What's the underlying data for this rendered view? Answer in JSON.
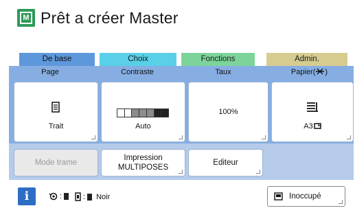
{
  "header": {
    "title": "Prêt a créer Master",
    "icon": "master-icon"
  },
  "tabs": [
    {
      "label": "De base",
      "color": "#5e98dc",
      "active": true
    },
    {
      "label": "Choix",
      "color": "#59d0e8"
    },
    {
      "label": "Fonctions",
      "color": "#7dd49a"
    },
    {
      "label": "Admin.",
      "color": "#d7cc90"
    }
  ],
  "columns": [
    {
      "label": "Page",
      "value": "Trait",
      "icon": "document-icon"
    },
    {
      "label": "Contraste",
      "value": "Auto",
      "icon": "contrast-scale-icon"
    },
    {
      "label": "Taux",
      "value": "100%"
    },
    {
      "label": "Papier(",
      "label_icon": "paper-feed-icon",
      "label_suffix": ")",
      "value": "A3",
      "icon": "stack-icon",
      "value_icon": "paper-orientation-icon"
    }
  ],
  "actions": {
    "mode_trame": "Mode trame",
    "impression_line1": "Impression",
    "impression_line2": "MULTIPOSES",
    "editeur": "Editeur"
  },
  "footer": {
    "info": "i",
    "ink_label": "Noir",
    "status": "Inoccupé"
  },
  "colors": {
    "panel_top": "#86aee2",
    "panel_bottom": "#b6cbea",
    "info_button": "#2d6dc4",
    "header_icon": "#2e9a57"
  }
}
